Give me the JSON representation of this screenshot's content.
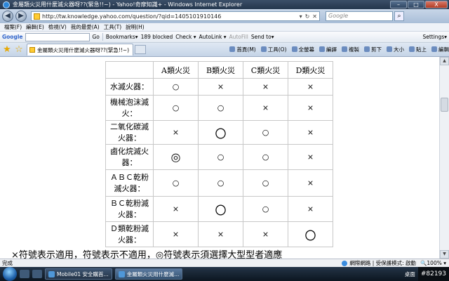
{
  "window": {
    "title": "金屬類火災用什麼滅火器呀??(緊急!!~) - Yahoo!奇摩知識+ - Windows Internet Explorer",
    "min": "–",
    "max": "□",
    "close": "X"
  },
  "address": {
    "url": "http://tw.knowledge.yahoo.com/question/?qid=1405101910146",
    "search_placeholder": "Google"
  },
  "menu": [
    "檔案(F)",
    "編輯(E)",
    "檢視(V)",
    "我的最愛(A)",
    "工具(T)",
    "說明(H)"
  ],
  "google_toolbar": {
    "logo": "Google",
    "go": "Go",
    "bookmarks": "Bookmarks▾",
    "blocked": "189 blocked",
    "check": "Check ▾",
    "autolink": "AutoLink ▾",
    "autofill": "AutoFill",
    "sendto": "Send to▾",
    "settings": "Settings▾"
  },
  "tab": {
    "label": "金屬類火災用什麼滅火器呀??(緊急!!~)"
  },
  "command_bar": [
    "首頁(M)",
    "工具(O)",
    "全螢幕",
    "編譯",
    "複製",
    "剪下",
    "大小",
    "貼上",
    "編輯"
  ],
  "table": {
    "headers": [
      "",
      "A類火災",
      "B類火災",
      "C類火災",
      "D類火災"
    ],
    "rows": [
      {
        "label": "水滅火器：",
        "cells": [
          "○",
          "×",
          "×",
          "×"
        ]
      },
      {
        "label": "機械泡沫滅火：",
        "cells": [
          "○",
          "○",
          "×",
          "×"
        ]
      },
      {
        "label": "二氧化碳滅火器：",
        "cells": [
          "×",
          "〇",
          "○",
          "×"
        ]
      },
      {
        "label": "鹵化烷滅火器：",
        "cells": [
          "◎",
          "○",
          "○",
          "×"
        ]
      },
      {
        "label": "ＡＢＣ乾粉滅火器：",
        "cells": [
          "○",
          "○",
          "○",
          "×"
        ]
      },
      {
        "label": "ＢＣ乾粉滅火器：",
        "cells": [
          "×",
          "〇",
          "○",
          "×"
        ]
      },
      {
        "label": "Ｄ類乾粉滅火器：",
        "cells": [
          "×",
          "×",
          "×",
          "〇"
        ]
      }
    ]
  },
  "bottom_text": "×符號表示適用，符號表示不適用，◎符號表示須選擇大型型者適應",
  "status": {
    "done": "完成",
    "zone": "網際網路 | 受保護模式: 啟動",
    "zoom": "🔍100% ▾"
  },
  "taskbar": {
    "tasks": [
      "Mobile01 安全購首...",
      "金屬類火災用什麼滅..."
    ],
    "desktop": "桌面",
    "clock": "#82193"
  }
}
